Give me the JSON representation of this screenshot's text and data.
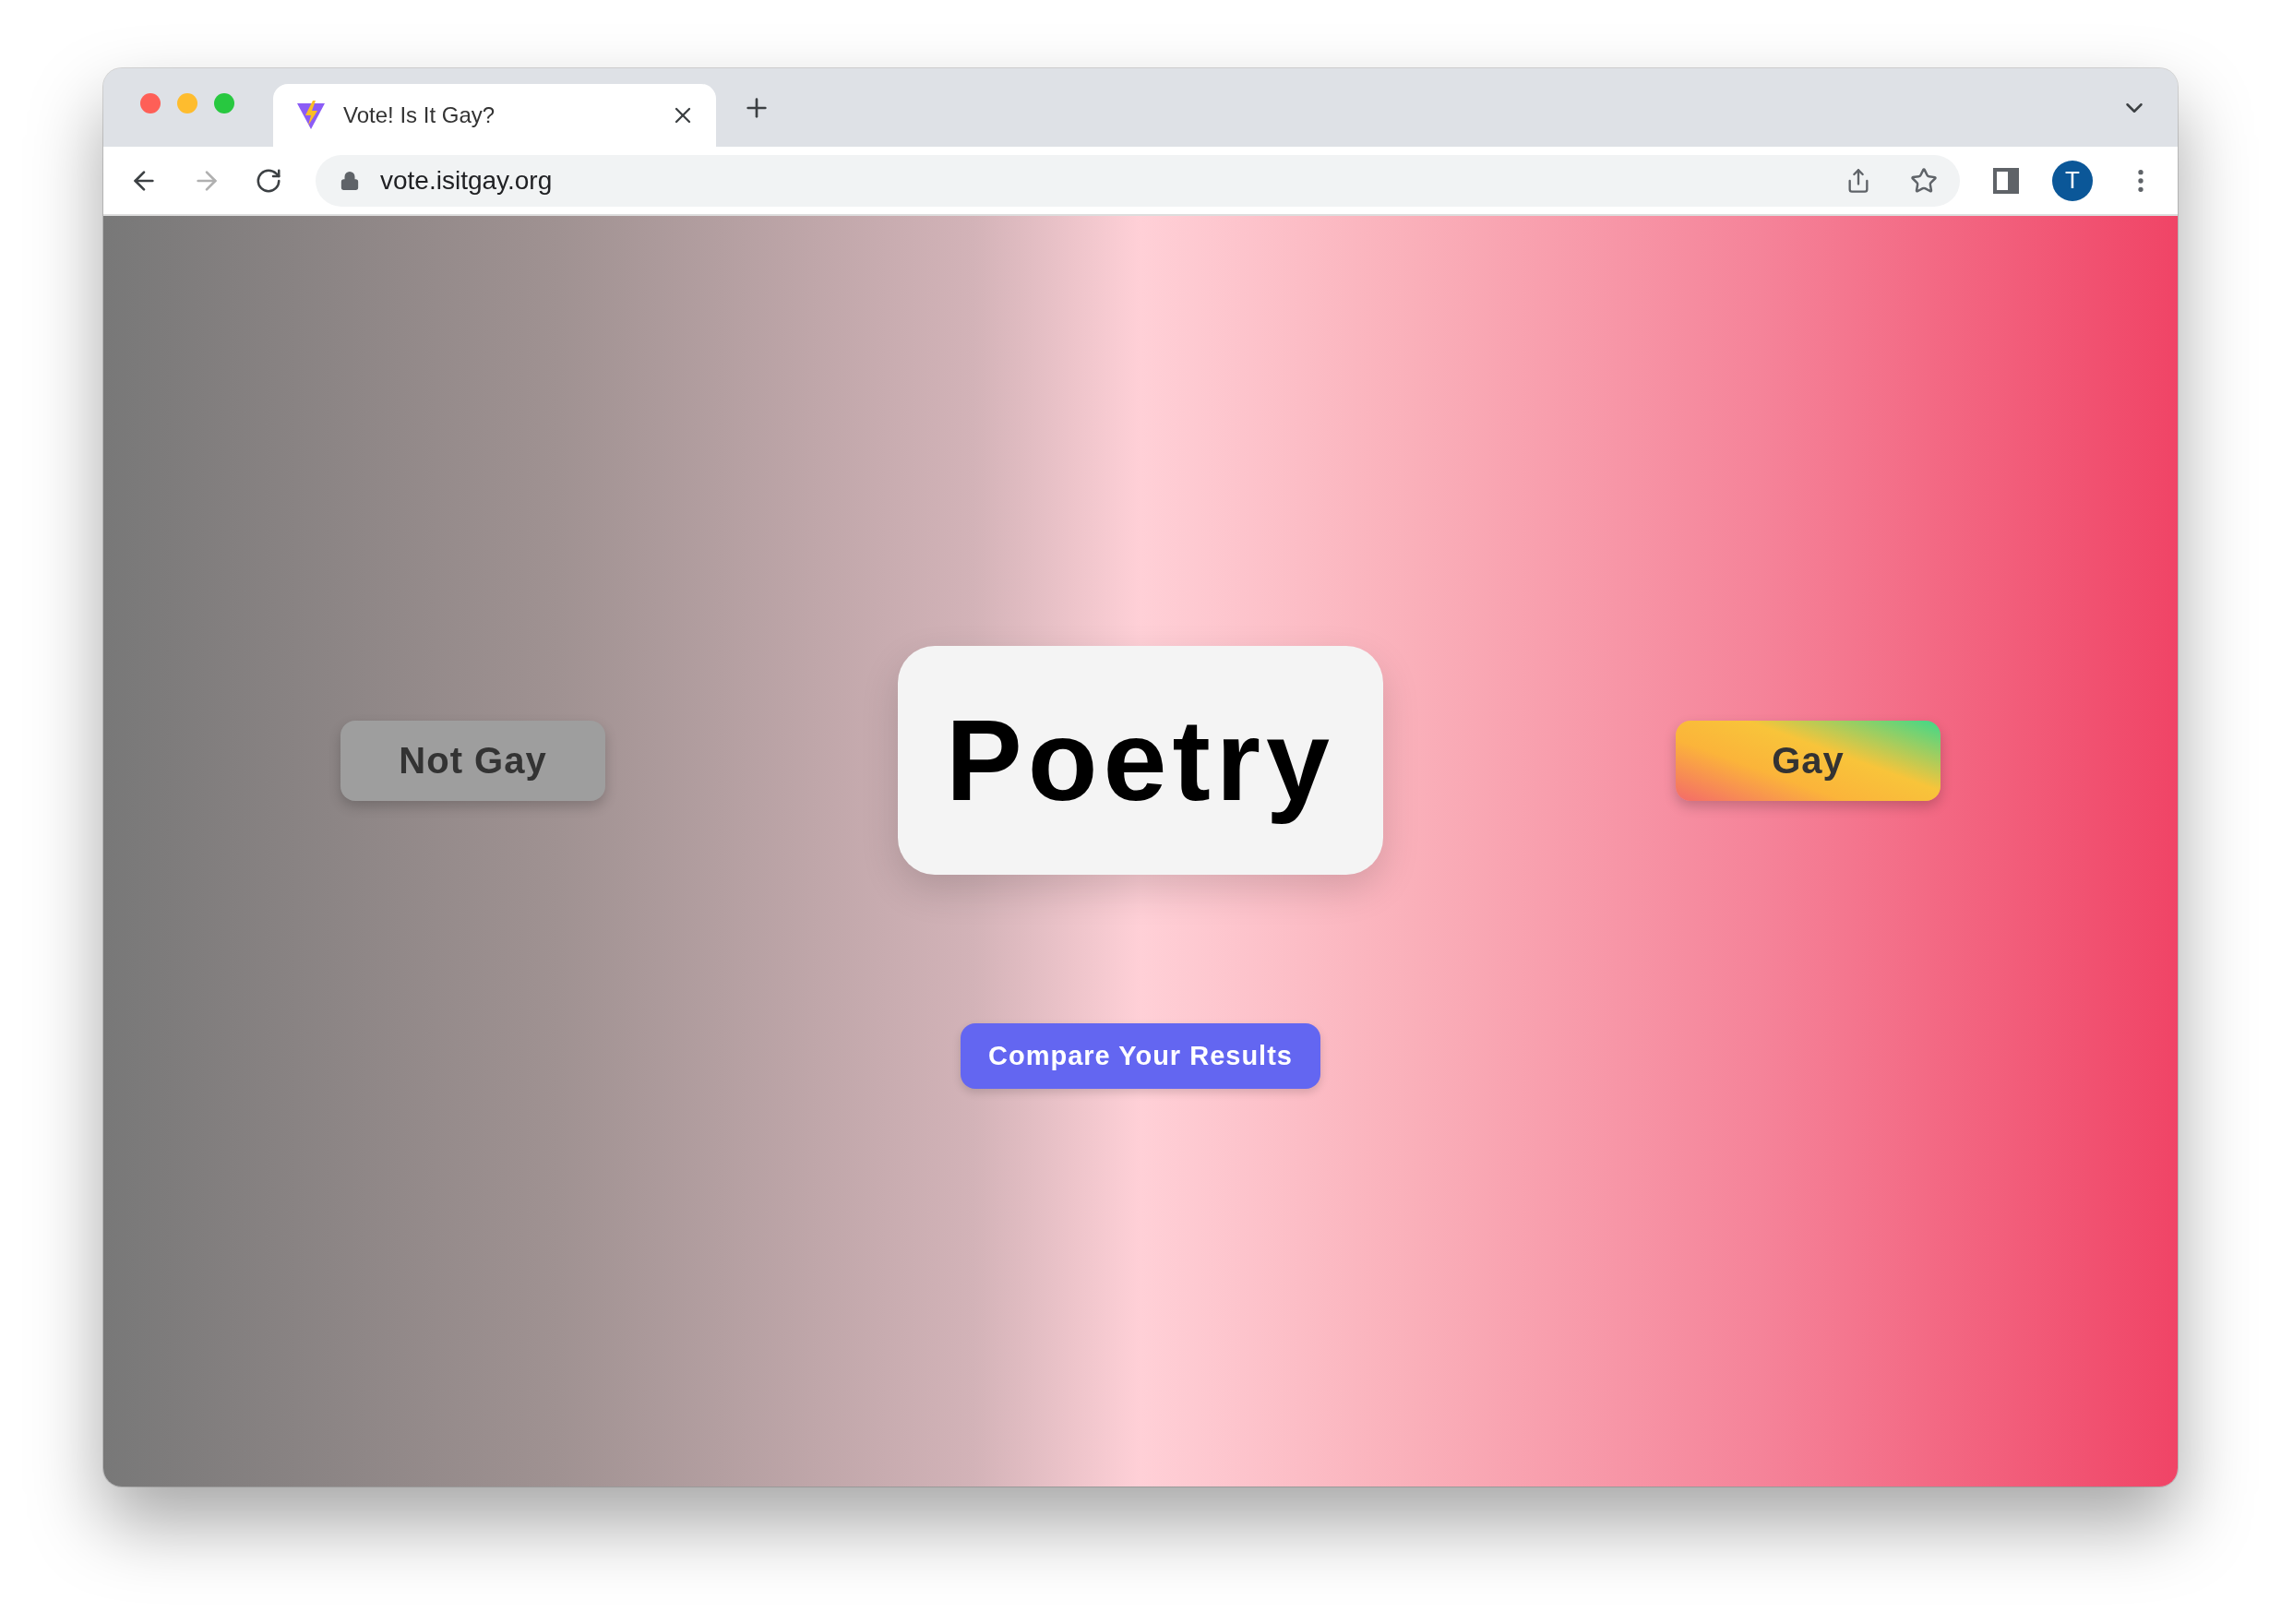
{
  "browser": {
    "tab_title": "Vote! Is It Gay?",
    "url": "vote.isitgay.org",
    "profile_initial": "T"
  },
  "page": {
    "topic": "Poetry",
    "vote_buttons": [
      {
        "label": "Not Gay",
        "kind": "not"
      },
      {
        "label": "Gay",
        "kind": "gay"
      }
    ],
    "compare_button": "Compare Your Results"
  }
}
